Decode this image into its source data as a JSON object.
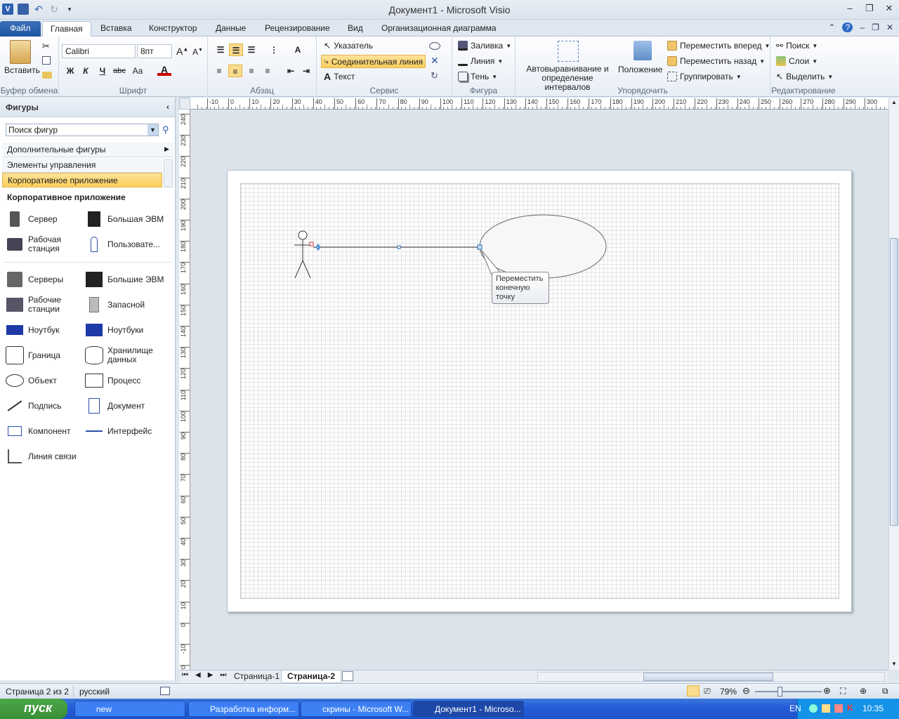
{
  "window": {
    "title": "Документ1  -  Microsoft Visio"
  },
  "qat": {
    "app_icon": "V"
  },
  "tabs": [
    {
      "label": "Файл"
    },
    {
      "label": "Главная"
    },
    {
      "label": "Вставка"
    },
    {
      "label": "Конструктор"
    },
    {
      "label": "Данные"
    },
    {
      "label": "Рецензирование"
    },
    {
      "label": "Вид"
    },
    {
      "label": "Организационная диаграмма"
    }
  ],
  "ribbon": {
    "clipboard": {
      "name": "Буфер обмена",
      "paste": "Вставить"
    },
    "font": {
      "name": "Шрифт",
      "family": "Calibri",
      "size": "8пт",
      "bold": "Ж",
      "italic": "К",
      "underline": "Ч",
      "strike": "abc",
      "case": "Aa",
      "color": "A"
    },
    "paragraph": {
      "name": "Абзац"
    },
    "tools": {
      "name": "Сервис",
      "pointer": "Указатель",
      "connector": "Соединительная линия",
      "text": "Текст"
    },
    "shape": {
      "name": "Фигура",
      "fill": "Заливка",
      "line": "Линия",
      "shadow": "Тень"
    },
    "arrange": {
      "name": "Упорядочить",
      "autoalign": "Автовыравнивание и определение интервалов",
      "position": "Положение",
      "front": "Переместить вперед",
      "back": "Переместить назад",
      "group": "Группировать"
    },
    "editing": {
      "name": "Редактирование",
      "find": "Поиск",
      "layers": "Слои",
      "select": "Выделить"
    }
  },
  "panel": {
    "title": "Фигуры",
    "search_placeholder": "Поиск фигур",
    "stencils": [
      "Дополнительные фигуры",
      "Элементы управления",
      "Корпоративное приложение"
    ],
    "section": "Корпоративное приложение",
    "shapes_top": [
      "Сервер",
      "Большая ЭВМ",
      "Рабочая станция",
      "Пользовате..."
    ],
    "shapes": [
      "Серверы",
      "Большие ЭВМ",
      "Рабочие станции",
      "Запасной",
      "Ноутбук",
      "Ноутбуки",
      "Граница",
      "Хранилище данных",
      "Объект",
      "Процесс",
      "Подпись",
      "Документ",
      "Компонент",
      "Интерфейс",
      "Линия связи"
    ]
  },
  "ruler": {
    "h": [
      "-10",
      "0",
      "10",
      "20",
      "30",
      "40",
      "50",
      "60",
      "70",
      "80",
      "90",
      "100",
      "110",
      "120",
      "130",
      "140",
      "150",
      "160",
      "170",
      "180",
      "190",
      "200",
      "210",
      "220",
      "230",
      "240",
      "250",
      "260",
      "270",
      "280",
      "290",
      "300"
    ],
    "v": [
      "240",
      "230",
      "220",
      "210",
      "200",
      "190",
      "180",
      "170",
      "160",
      "150",
      "140",
      "130",
      "120",
      "110",
      "100",
      "90",
      "80",
      "70",
      "60",
      "50",
      "40",
      "30",
      "20",
      "10",
      "0",
      "-10",
      "-20"
    ]
  },
  "tooltip": "Переместить конечную точку",
  "pagetabs": [
    "Страница-1",
    "Страница-2"
  ],
  "status": {
    "page": "Страница 2 из 2",
    "lang": "русский",
    "zoom": "79%"
  },
  "taskbar": {
    "start": "пуск",
    "items": [
      "new",
      "Разработка информ...",
      "скрины - Microsoft W...",
      "Документ1 - Microso..."
    ],
    "lang": "EN",
    "time": "10:35"
  }
}
